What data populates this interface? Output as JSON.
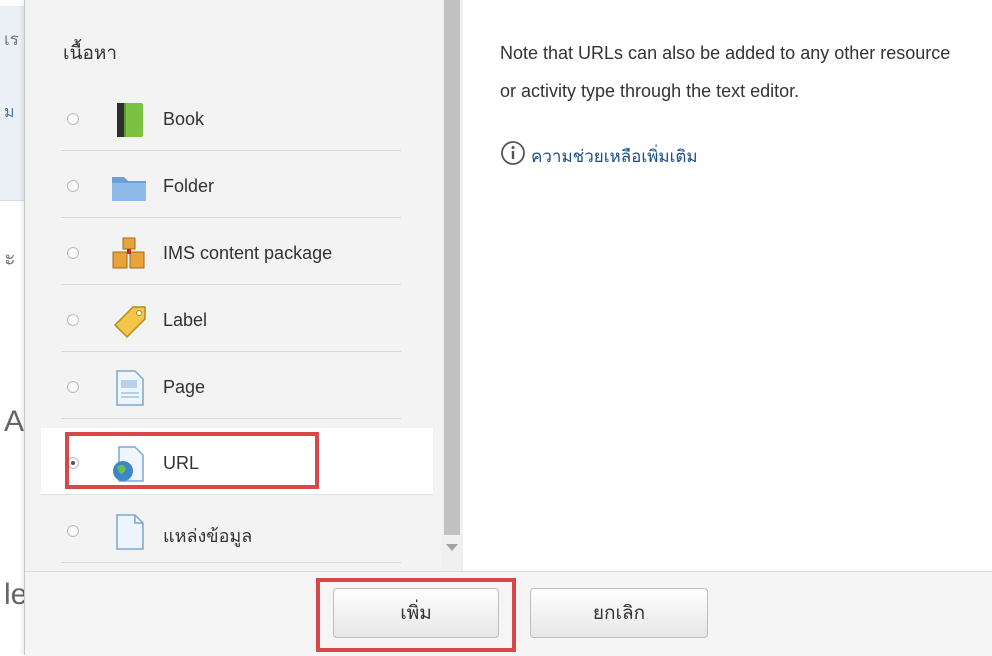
{
  "background": {
    "fragments": [
      "เร",
      "ม",
      "ะ",
      "A",
      "le"
    ]
  },
  "chooser": {
    "section_title": "เนื้อหา",
    "options": [
      {
        "label": "Book",
        "icon": "book-icon",
        "selected": false
      },
      {
        "label": "Folder",
        "icon": "folder-icon",
        "selected": false
      },
      {
        "label": "IMS content package",
        "icon": "ims-package-icon",
        "selected": false
      },
      {
        "label": "Label",
        "icon": "label-tag-icon",
        "selected": false
      },
      {
        "label": "Page",
        "icon": "page-icon",
        "selected": false
      },
      {
        "label": "URL",
        "icon": "url-globe-icon",
        "selected": true
      },
      {
        "label": "แหล่งข้อมูล",
        "icon": "file-icon",
        "selected": false
      }
    ]
  },
  "help": {
    "text": "Note that URLs can also be added to any other resource or activity type through the text editor.",
    "link_label": "ความช่วยเหลือเพิ่มเติม",
    "link_icon": "info-icon"
  },
  "footer": {
    "add_label": "เพิ่ม",
    "cancel_label": "ยกเลิก"
  },
  "colors": {
    "highlight": "#d9474a",
    "link": "#1a4d8a",
    "panel_bg": "#f3f3f3"
  }
}
